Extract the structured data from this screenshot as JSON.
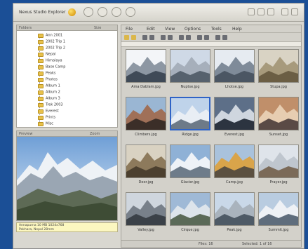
{
  "titlebar": {
    "app_title": "Nexus Studio Explorer"
  },
  "tree": {
    "header_left": "Folders",
    "header_right": "Size",
    "items": [
      "Ann 2001",
      "2002 Trip 1",
      "2002 Trip 2",
      "Nepal",
      "Himalaya",
      "Base Camp",
      "Peaks",
      "Photos",
      "Album 1",
      "Album 2",
      "Album 3",
      "Trek 2003",
      "Everest",
      "Prints",
      "Misc"
    ]
  },
  "preview": {
    "header_left": "Preview",
    "header_right": "Zoom"
  },
  "info": {
    "line1": "Annapurna 10 MB  1024x768",
    "line2": "Pokhara, Nepal  28mm"
  },
  "menu": {
    "items": [
      "File",
      "Edit",
      "View",
      "Options",
      "Tools",
      "Help"
    ]
  },
  "thumbs": [
    {
      "caption": "Ama Dablam.jpg"
    },
    {
      "caption": "Nuptse.jpg"
    },
    {
      "caption": "Lhotse.jpg"
    },
    {
      "caption": "Stupa.jpg"
    },
    {
      "caption": "Climbers.jpg"
    },
    {
      "caption": "Ridge.jpg"
    },
    {
      "caption": "Everest.jpg"
    },
    {
      "caption": "Sunset.jpg"
    },
    {
      "caption": "Door.jpg"
    },
    {
      "caption": "Glacier.jpg"
    },
    {
      "caption": "Camp.jpg"
    },
    {
      "caption": "Prayer.jpg"
    },
    {
      "caption": "Valley.jpg"
    },
    {
      "caption": "Cirque.jpg"
    },
    {
      "caption": "Peak.jpg"
    },
    {
      "caption": "Summit.jpg"
    }
  ],
  "status": {
    "left": "Files: 16",
    "right": "Selected: 1 of 16"
  }
}
